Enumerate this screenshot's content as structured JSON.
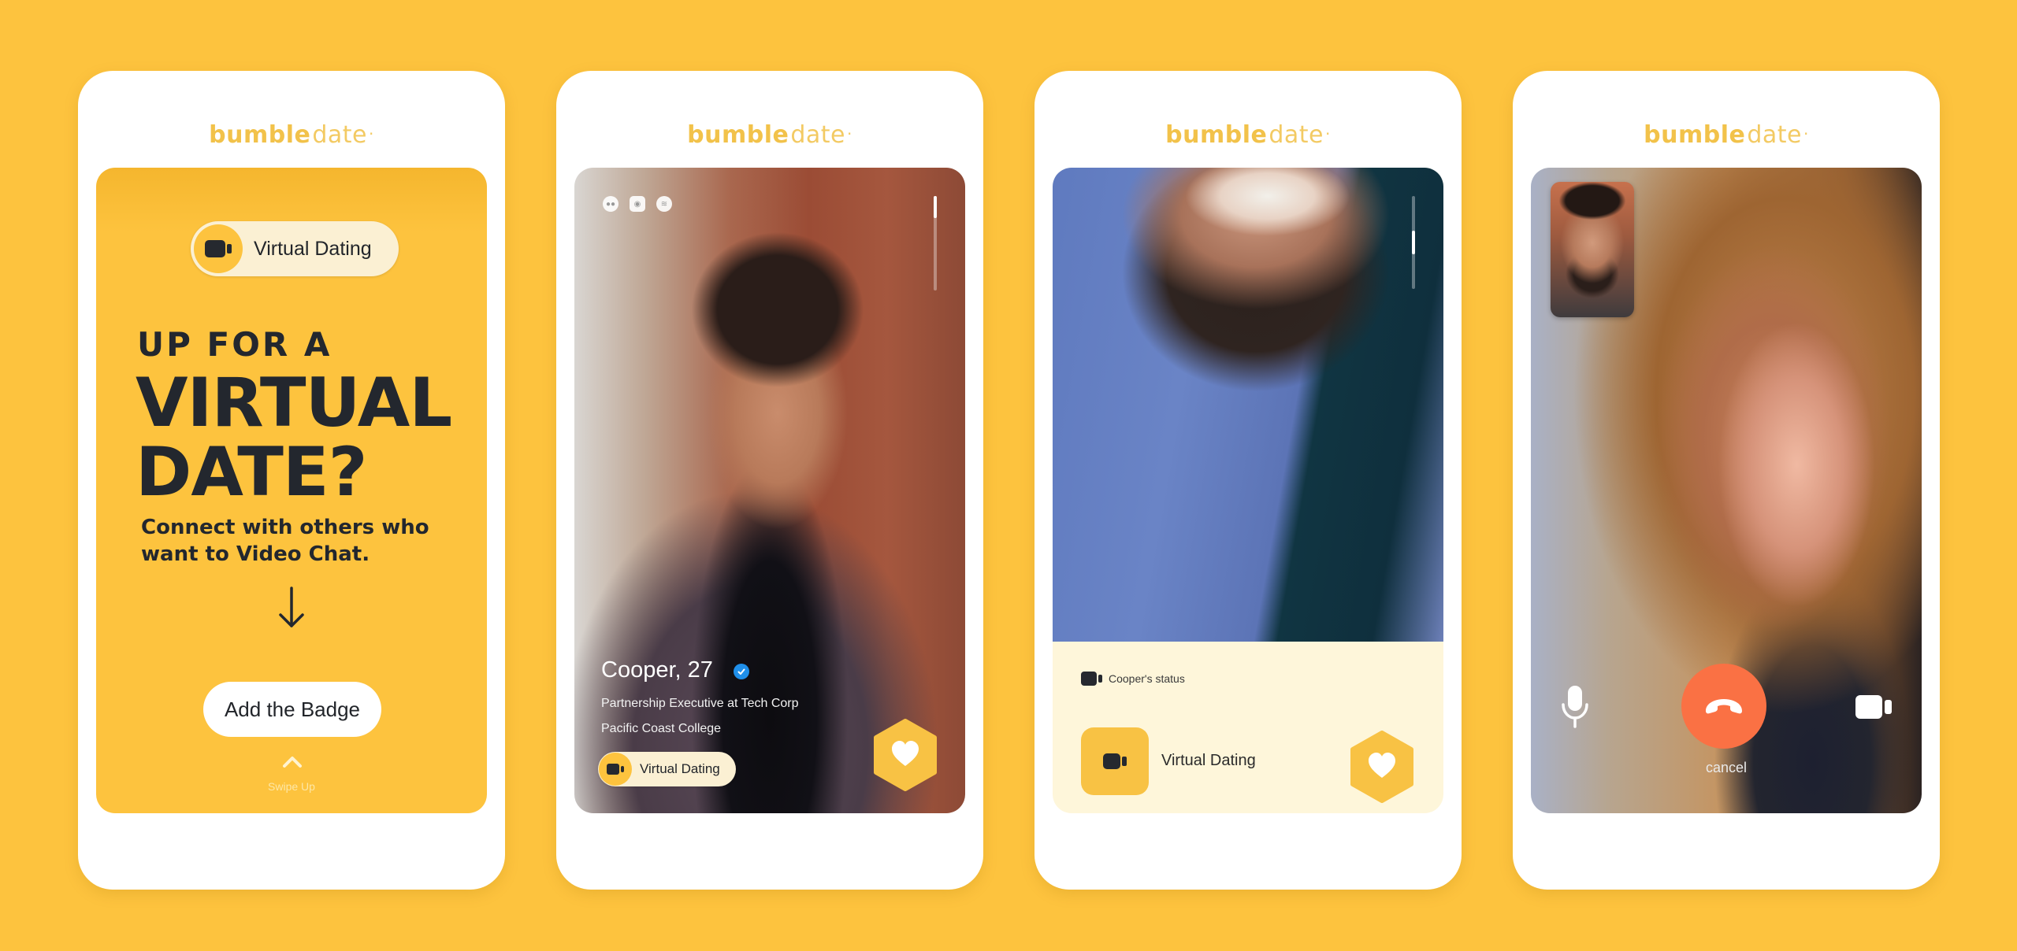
{
  "brand": {
    "logo_bold": "bumble",
    "logo_light": "date",
    "logo_dot": "·",
    "colors": {
      "background": "#FDC33E",
      "accent_yellow": "#F8C244",
      "dark_text": "#23272E",
      "badge_cream": "#FBF0D3",
      "status_panel": "#FEF6DA",
      "verified_blue": "#1F8FEA",
      "end_call_orange": "#FA7144"
    }
  },
  "screen1": {
    "badge_label": "Virtual Dating",
    "badge_icon": "video-camera-icon",
    "headline_small": "UP FOR A",
    "headline_line1": "VIRTUAL",
    "headline_line2": "DATE?",
    "subline": "Connect with others who want to Video Chat.",
    "arrow_icon": "arrow-down-icon",
    "button_label": "Add the Badge",
    "swipe_icon": "chevron-up-icon",
    "swipe_label": "Swipe Up"
  },
  "screen2": {
    "social_icons": [
      "flickr-icon",
      "instagram-icon",
      "spotify-icon"
    ],
    "name_age": "Cooper, 27",
    "verified_icon": "verified-check-icon",
    "job": "Partnership Executive at Tech Corp",
    "school": "Pacific Coast College",
    "badge_label": "Virtual Dating",
    "like_icon": "heart-hexagon-icon"
  },
  "screen3": {
    "status_title": "Cooper's status",
    "status_label": "Virtual Dating",
    "like_icon": "heart-hexagon-icon"
  },
  "screen4": {
    "mic_icon": "microphone-icon",
    "end_call_icon": "phone-hangup-icon",
    "camera_icon": "video-camera-icon",
    "cancel_label": "cancel"
  }
}
